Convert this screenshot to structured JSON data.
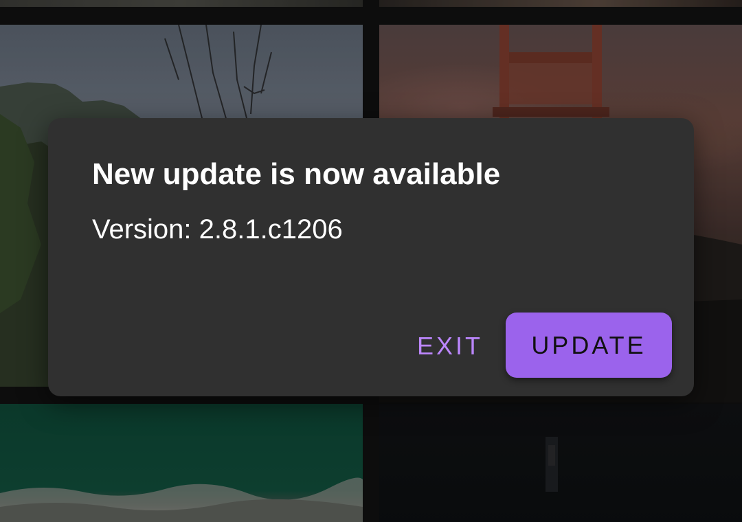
{
  "dialog": {
    "title": "New update is now available",
    "message": "Version: 2.8.1.c1206",
    "exit_label": "EXIT",
    "update_label": "UPDATE"
  },
  "colors": {
    "dialog_background": "#303030",
    "accent": "#9b63ec",
    "exit_text": "#bb86fc",
    "title_text": "#ffffff"
  },
  "background_photos": [
    "mountain-landscape-photo",
    "golden-gate-bridge-sunset-photo",
    "ocean-waves-aerial-photo",
    "dark-night-photo"
  ]
}
